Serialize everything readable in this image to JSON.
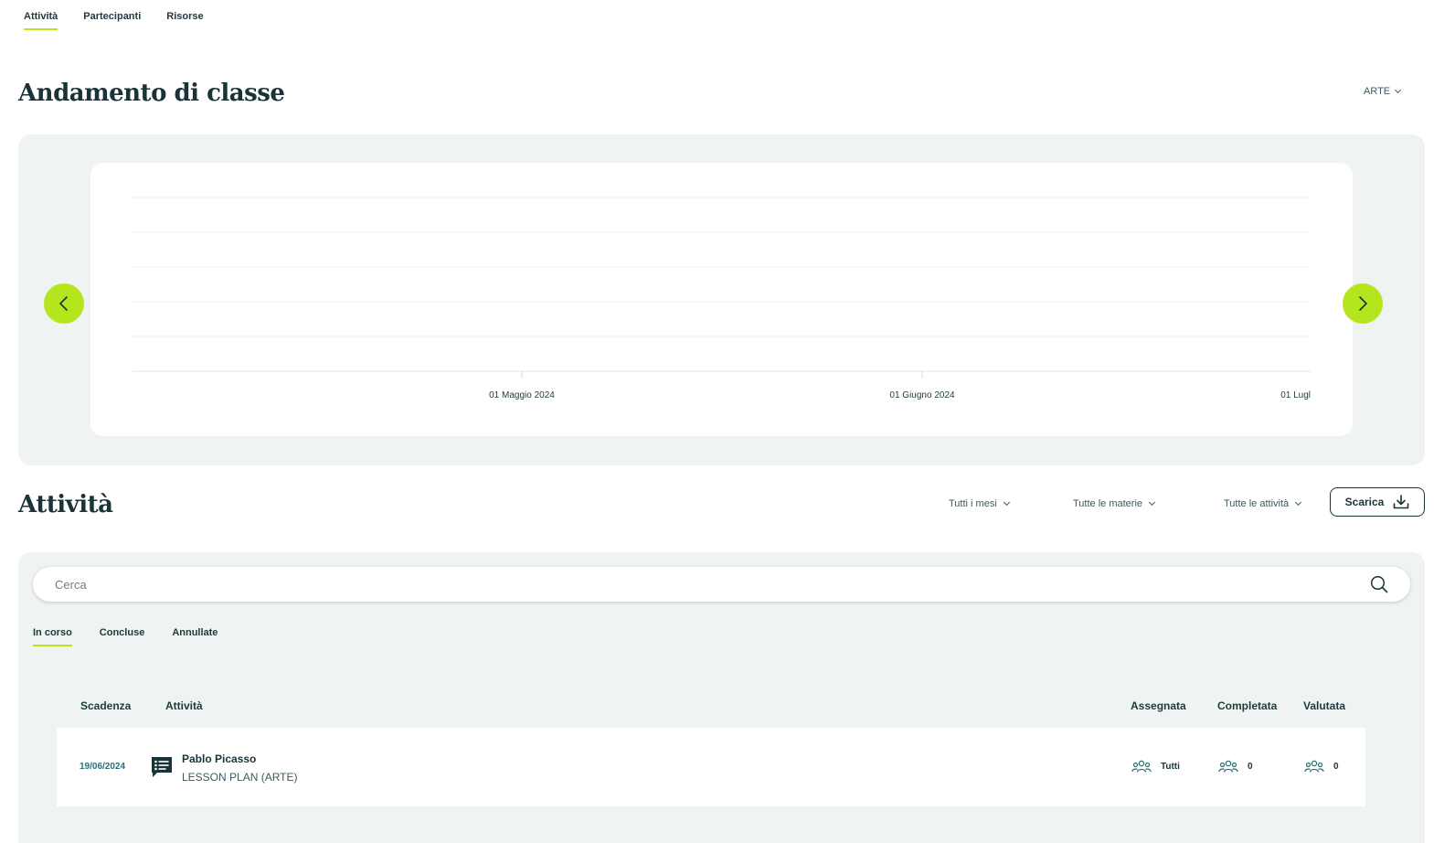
{
  "top_tabs": [
    {
      "label": "Attività",
      "active": true
    },
    {
      "label": "Partecipanti",
      "active": false
    },
    {
      "label": "Risorse",
      "active": false
    }
  ],
  "trend": {
    "title": "Andamento di classe",
    "subject_filter": "ARTE"
  },
  "chart_data": {
    "type": "line",
    "title": "",
    "xlabel": "",
    "ylabel": "",
    "x_tick_labels": [
      "01 Maggio 2024",
      "01 Giugno 2024",
      "01 Lugl"
    ],
    "series": [],
    "grid": true,
    "gridlines": 6
  },
  "activities": {
    "title": "Attività",
    "filters": {
      "months": "Tutti i mesi",
      "subjects": "Tutte le materie",
      "activities": "Tutte le attività"
    },
    "download_label": "Scarica",
    "search_placeholder": "Cerca",
    "status_tabs": [
      {
        "label": "In corso",
        "active": true
      },
      {
        "label": "Concluse",
        "active": false
      },
      {
        "label": "Annullate",
        "active": false
      }
    ],
    "columns": {
      "due": "Scadenza",
      "activity": "Attività",
      "assigned": "Assegnata",
      "completed": "Completata",
      "graded": "Valutata"
    },
    "rows": [
      {
        "due": "19/06/2024",
        "title": "Pablo Picasso",
        "subtitle": "LESSON PLAN (ARTE)",
        "assigned": "Tutti",
        "completed": "0",
        "graded": "0",
        "icon": "lesson-plan-icon"
      }
    ]
  },
  "colors": {
    "accent": "#b5e61d",
    "primary_text": "#1a3338",
    "panel_bg": "#eff3f2",
    "link_teal": "#2b6f78"
  }
}
